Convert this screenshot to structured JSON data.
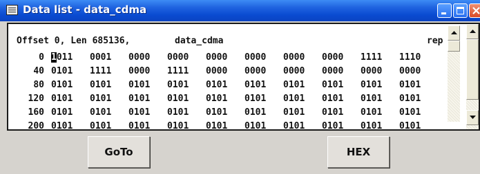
{
  "window": {
    "title": "Data list - data_cdma",
    "controls": [
      "minimize-icon",
      "maximize-icon",
      "close-icon"
    ]
  },
  "list": {
    "header": {
      "offset_text": "Offset 0, Len 685136,",
      "name": "data_cdma",
      "mode": "rep"
    },
    "rows": [
      {
        "offset": "0",
        "groups": [
          "1011",
          "0001",
          "0000",
          "0000",
          "0000",
          "0000",
          "0000",
          "0000",
          "1111",
          "1110"
        ],
        "cursor_char": "1"
      },
      {
        "offset": "40",
        "groups": [
          "0101",
          "1111",
          "0000",
          "1111",
          "0000",
          "0000",
          "0000",
          "0000",
          "0000",
          "0000"
        ]
      },
      {
        "offset": "80",
        "groups": [
          "0101",
          "0101",
          "0101",
          "0101",
          "0101",
          "0101",
          "0101",
          "0101",
          "0101",
          "0101"
        ]
      },
      {
        "offset": "120",
        "groups": [
          "0101",
          "0101",
          "0101",
          "0101",
          "0101",
          "0101",
          "0101",
          "0101",
          "0101",
          "0101"
        ]
      },
      {
        "offset": "160",
        "groups": [
          "0101",
          "0101",
          "0101",
          "0101",
          "0101",
          "0101",
          "0101",
          "0101",
          "0101",
          "0101"
        ]
      },
      {
        "offset": "200",
        "groups": [
          "0101",
          "0101",
          "0101",
          "0101",
          "0101",
          "0101",
          "0101",
          "0101",
          "0101",
          "0101"
        ]
      }
    ]
  },
  "buttons": {
    "goto": "GoTo",
    "hex": "HEX"
  },
  "colors": {
    "titlebar": "#0a4bd1",
    "dialog_bg": "#d6d3ce",
    "list_bg": "#ffffff"
  }
}
